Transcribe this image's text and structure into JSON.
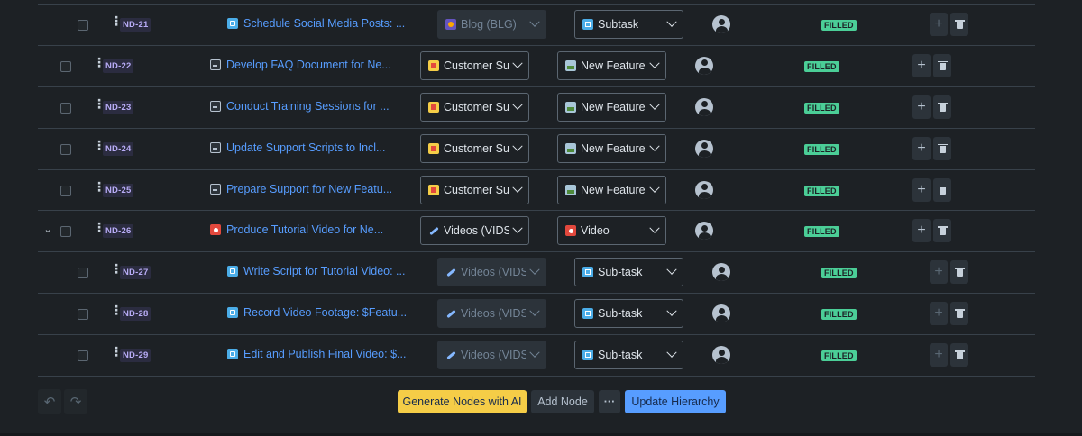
{
  "rows": [
    {
      "key": "ND-21",
      "summary": "Schedule Social Media Posts: ...",
      "summary_icon": "subtask",
      "project": "Blog (BLG)",
      "project_icon": "blog",
      "project_disabled": true,
      "type": "Subtask",
      "type_icon": "subtask",
      "status": "FILLED",
      "child": true,
      "expandable": false
    },
    {
      "key": "ND-22",
      "summary": "Develop FAQ Document for Ne...",
      "summary_icon": "story",
      "project": "Customer Support",
      "project_icon": "cs",
      "project_disabled": false,
      "type": "New Feature",
      "type_icon": "feature",
      "status": "FILLED",
      "child": false,
      "expandable": false
    },
    {
      "key": "ND-23",
      "summary": "Conduct Training Sessions for ...",
      "summary_icon": "story",
      "project": "Customer Support",
      "project_icon": "cs",
      "project_disabled": false,
      "type": "New Feature",
      "type_icon": "feature",
      "status": "FILLED",
      "child": false,
      "expandable": false
    },
    {
      "key": "ND-24",
      "summary": "Update Support Scripts to Incl...",
      "summary_icon": "story",
      "project": "Customer Support",
      "project_icon": "cs",
      "project_disabled": false,
      "type": "New Feature",
      "type_icon": "feature",
      "status": "FILLED",
      "child": false,
      "expandable": false
    },
    {
      "key": "ND-25",
      "summary": "Prepare Support for New Featu...",
      "summary_icon": "story",
      "project": "Customer Support",
      "project_icon": "cs",
      "project_disabled": false,
      "type": "New Feature",
      "type_icon": "feature",
      "status": "FILLED",
      "child": false,
      "expandable": false
    },
    {
      "key": "ND-26",
      "summary": "Produce Tutorial Video for Ne...",
      "summary_icon": "video",
      "project": "Videos (VIDS)",
      "project_icon": "vids",
      "project_disabled": false,
      "type": "Video",
      "type_icon": "video",
      "status": "FILLED",
      "child": false,
      "expandable": true
    },
    {
      "key": "ND-27",
      "summary": "Write Script for Tutorial Video: ...",
      "summary_icon": "subtask",
      "project": "Videos (VIDS)",
      "project_icon": "vids",
      "project_disabled": true,
      "type": "Sub-task",
      "type_icon": "subtask",
      "status": "FILLED",
      "child": true,
      "expandable": false
    },
    {
      "key": "ND-28",
      "summary": "Record Video Footage: $Featu...",
      "summary_icon": "subtask",
      "project": "Videos (VIDS)",
      "project_icon": "vids",
      "project_disabled": true,
      "type": "Sub-task",
      "type_icon": "subtask",
      "status": "FILLED",
      "child": true,
      "expandable": false
    },
    {
      "key": "ND-29",
      "summary": "Edit and Publish Final Video: $...",
      "summary_icon": "subtask",
      "project": "Videos (VIDS)",
      "project_icon": "vids",
      "project_disabled": true,
      "type": "Sub-task",
      "type_icon": "subtask",
      "status": "FILLED",
      "child": true,
      "expandable": false
    }
  ],
  "footer": {
    "undo_icon": "undo-icon",
    "redo_icon": "redo-icon",
    "generate_label": "Generate Nodes with AI",
    "add_node_label": "Add Node",
    "more_label": "···",
    "update_label": "Update Hierarchy"
  },
  "colors": {
    "background": "#1d2125",
    "link": "#579dff",
    "key": "#b8acf6",
    "status_filled": "#4bce97",
    "primary_button": "#579dff",
    "ai_button": "#f5cd47"
  }
}
